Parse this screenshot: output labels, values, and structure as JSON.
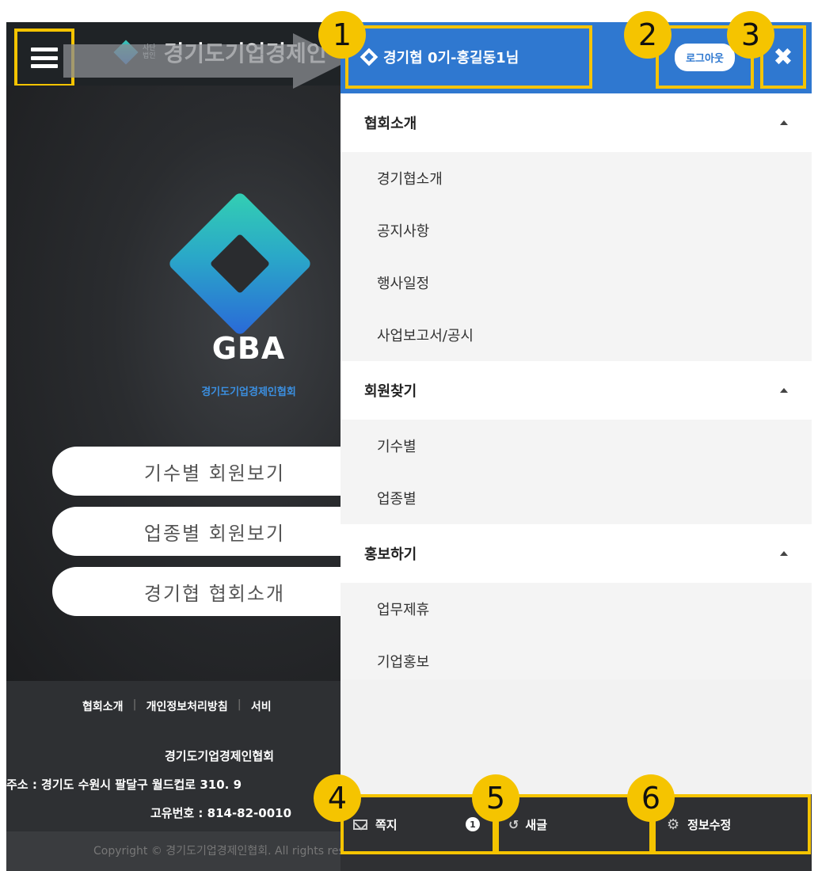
{
  "colors": {
    "highlight": "#f5c400",
    "drawer_header": "#2f78d0",
    "dark_bar": "#2f3033",
    "brand_teal": "#33d0b2",
    "brand_blue": "#2a68d8"
  },
  "main_page": {
    "header": {
      "menu_icon": "hamburger-icon",
      "legal_mark_top": "사단",
      "legal_mark_bottom": "법인",
      "site_name": "경기도기업경제인"
    },
    "hero": {
      "title": "GBA",
      "subtitle": "경기도기업경제인협회",
      "buttons": [
        "기수별 회원보기",
        "업종별 회원보기",
        "경기협 협회소개"
      ]
    },
    "footer": {
      "links": [
        "협회소개",
        "개인정보처리방침",
        "서비"
      ],
      "org_name": "경기도기업경제인협회",
      "address": "주소 : 경기도 수원시 팔달구 월드컵로 310. 9",
      "business_number": "고유번호 : 814-82-0010",
      "copyright": "Copyright © 경기도기업경제인협회. All rights reserve"
    },
    "scroll_top_icon": "arrow-up-icon"
  },
  "drawer": {
    "user_label": "경기협 0기-홍길동1님",
    "logout_label": "로그아웃",
    "close_icon": "close-icon",
    "sections": [
      {
        "title": "협회소개",
        "items": [
          "경기협소개",
          "공지사항",
          "행사일정",
          "사업보고서/공시"
        ]
      },
      {
        "title": "회원찾기",
        "items": [
          "기수별",
          "업종별"
        ]
      },
      {
        "title": "홍보하기",
        "items": [
          "업무제휴",
          "기업홍보"
        ]
      }
    ],
    "bottom_bar": {
      "notes_label": "쪽지",
      "notes_badge": "1",
      "new_posts_label": "새글",
      "edit_profile_label": "정보수정"
    }
  },
  "markers": [
    "1",
    "2",
    "3",
    "4",
    "5",
    "6"
  ]
}
